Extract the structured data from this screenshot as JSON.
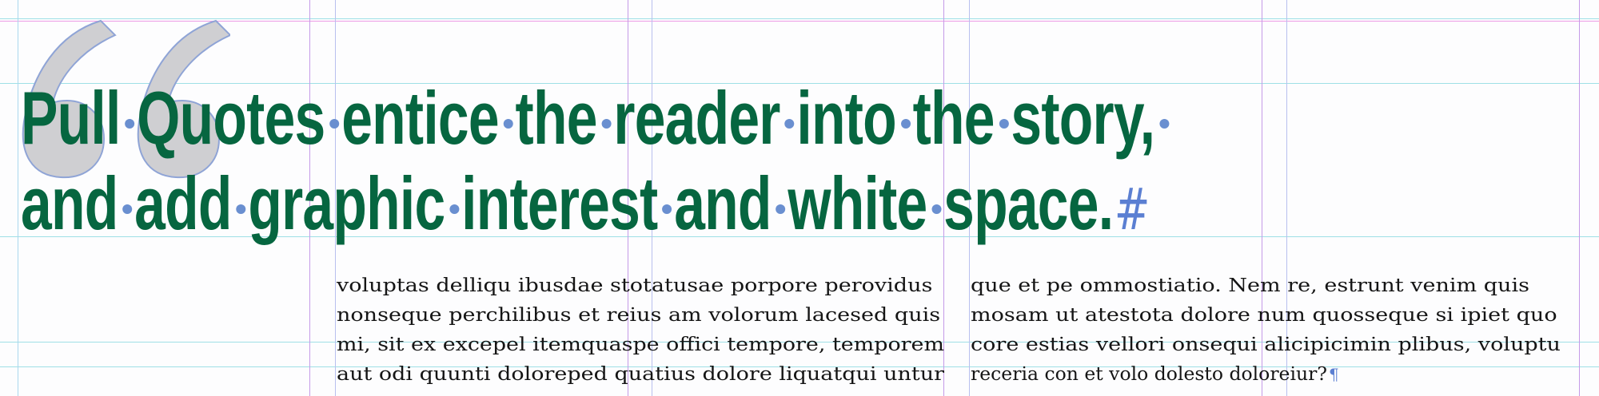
{
  "headline": {
    "line1_words": [
      "Pull",
      "Quotes",
      "entice",
      "the",
      "reader",
      "into",
      "the",
      "story,"
    ],
    "line2_words": [
      "and",
      "add",
      "graphic",
      "interest",
      "and",
      "white",
      "space."
    ],
    "end_mark": "#",
    "color": "#066640"
  },
  "quote_mark": {
    "icon": "open-double-quote-icon",
    "color": "#cfcfd2"
  },
  "body": {
    "left_column": [
      "voluptas delliqu ibusdae stotatusae porpore perovidus",
      "nonseque perchilibus et reius am volorum lacesed quis",
      "mi, sit ex excepel itemquaspe offici tempore, temporem",
      "aut odi quunti doloreped quatius dolore liquatqui untur"
    ],
    "right_column": [
      "que et pe ommostiatio. Nem re, estrunt venim quis",
      "mosam ut atestota dolore num quosseque si ipiet quo",
      "core estias vellori onsequi alicipicimin plibus, voluptu",
      "receria con et volo dolesto doloreiur?"
    ],
    "paragraph_mark": "¶"
  },
  "colors": {
    "guide_cyan": "#9fe0e6",
    "guide_magenta": "#ec9be6",
    "guide_violet": "#c59be8",
    "invisibles_blue": "#5b7fd2"
  }
}
